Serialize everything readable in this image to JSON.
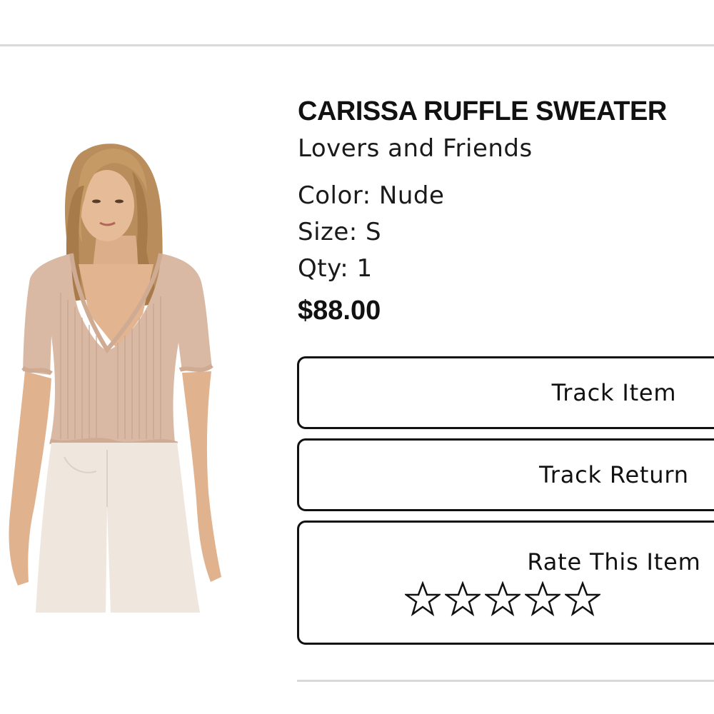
{
  "product": {
    "title": "CARISSA RUFFLE SWEATER",
    "brand": "Lovers and Friends",
    "color_line": "Color: Nude",
    "size_line": "Size: S",
    "qty_line": "Qty: 1",
    "price": "$88.00",
    "image_description_icon": "product-photo"
  },
  "actions": {
    "track_item_label": "Track Item",
    "track_return_label": "Track Return",
    "rate_label": "Rate This Item",
    "rating_stars": 5,
    "rating_value": 0
  },
  "colors": {
    "sweater": "#d9b9a3",
    "pants": "#efe6de",
    "skin": "#e2b590",
    "hair": "#b08553",
    "border": "#111111",
    "rule": "#d9d9d9"
  }
}
